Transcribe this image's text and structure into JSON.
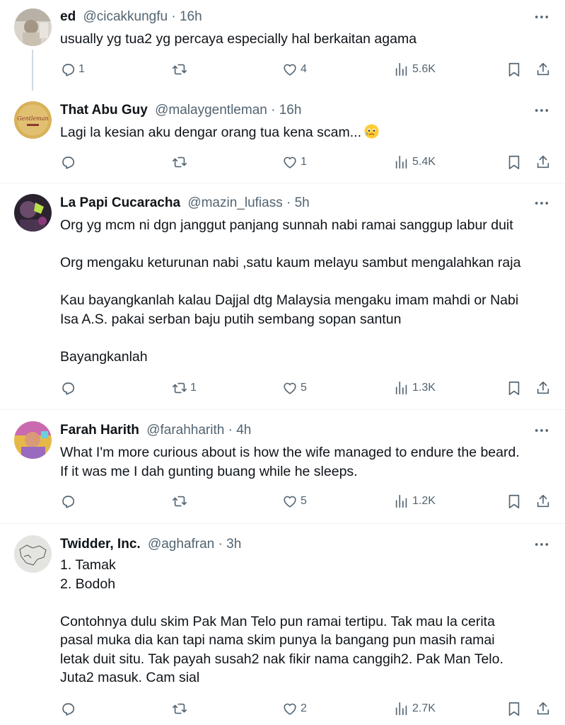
{
  "tweets": [
    {
      "name": "ed",
      "handle": "@cicakkungfu",
      "dot": "·",
      "time": "16h",
      "text": [
        "usually yg tua2 yg percaya especially hal berkaitan agama"
      ],
      "replies": "1",
      "retweets": "",
      "likes": "4",
      "views": "5.6K"
    },
    {
      "name": "That Abu Guy",
      "handle": "@malaygentleman",
      "dot": "·",
      "time": "16h",
      "text": [
        "Lagi la kesian aku dengar orang tua kena scam..."
      ],
      "emoji": "face-holding-back-tears",
      "replies": "",
      "retweets": "",
      "likes": "1",
      "views": "5.4K"
    },
    {
      "name": "La Papi Cucaracha",
      "handle": "@mazin_lufiass",
      "dot": "·",
      "time": "5h",
      "text": [
        "Org yg mcm ni dgn janggut panjang sunnah nabi ramai sanggup labur duit",
        "",
        "Org mengaku keturunan nabi ,satu kaum melayu sambut mengalahkan raja",
        "",
        "Kau bayangkanlah kalau Dajjal dtg Malaysia mengaku imam mahdi or Nabi",
        "Isa A.S. pakai serban baju putih sembang sopan santun",
        "",
        "Bayangkanlah"
      ],
      "replies": "",
      "retweets": "1",
      "likes": "5",
      "views": "1.3K"
    },
    {
      "name": "Farah Harith",
      "handle": "@farahharith",
      "dot": "·",
      "time": "4h",
      "text": [
        "What I'm more curious about is how the wife managed to endure the beard.",
        "If it was me I dah gunting buang while he sleeps."
      ],
      "replies": "",
      "retweets": "",
      "likes": "5",
      "views": "1.2K"
    },
    {
      "name": "Twidder, Inc.",
      "handle": "@aghafran",
      "dot": "·",
      "time": "3h",
      "text": [
        "1. Tamak",
        "2. Bodoh",
        "",
        "Contohnya dulu skim Pak Man Telo pun ramai tertipu. Tak mau la cerita",
        "pasal muka dia kan tapi nama skim punya la bangang pun masih ramai",
        "letak duit situ. Tak payah susah2 nak fikir nama canggih2. Pak Man Telo.",
        "Juta2 masuk. Cam sial"
      ],
      "replies": "",
      "retweets": "",
      "likes": "2",
      "views": "2.7K"
    }
  ],
  "icons": {
    "reply": "reply-icon",
    "retweet": "retweet-icon",
    "like": "like-icon",
    "views": "views-icon",
    "bookmark": "bookmark-icon",
    "share": "share-icon",
    "more": "more-icon"
  },
  "colors": {
    "text": "#0f1419",
    "muted": "#536471",
    "divider": "#eff3f4",
    "thread": "#cfd9de"
  }
}
